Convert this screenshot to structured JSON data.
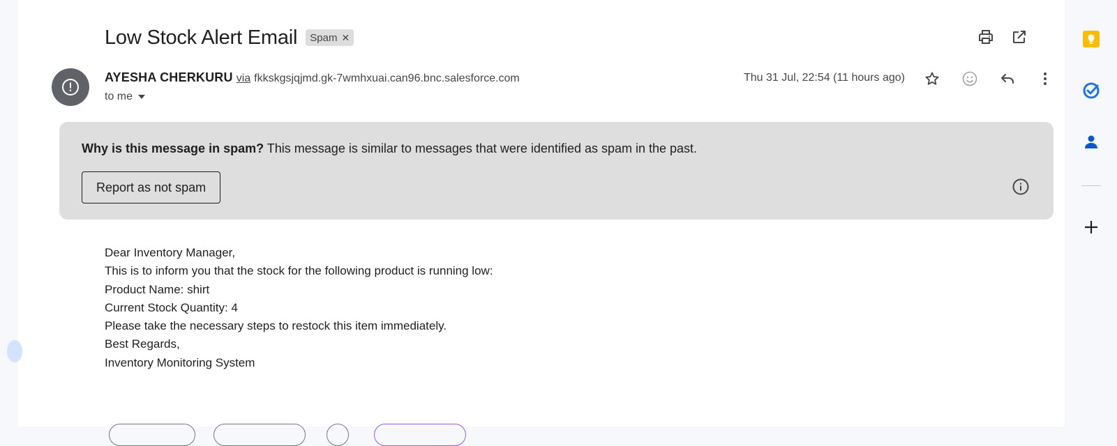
{
  "email": {
    "subject": "Low Stock Alert Email",
    "label": "Spam",
    "sender_name": "AYESHA CHERKURU",
    "via_text": "via",
    "sender_domain": "fkkskgsjqjmd.gk-7wmhxuai.can96.bnc.salesforce.com",
    "recipient": "to me",
    "date": "Thu 31 Jul, 22:54 (11 hours ago)"
  },
  "spam_banner": {
    "question": "Why is this message in spam?",
    "explanation": "This message is similar to messages that were identified as spam in the past.",
    "button_label": "Report as not spam"
  },
  "body_lines": [
    "Dear Inventory Manager,",
    "This is to inform you that the stock for the following product is running low:",
    "Product Name: shirt",
    "Current Stock Quantity: 4",
    "Please take the necessary steps to restock this item immediately.",
    "Best Regards,",
    "Inventory Monitoring System"
  ],
  "icons": {
    "top": [
      "print-icon",
      "open-in-new-window-icon"
    ],
    "message_actions": [
      "star-icon",
      "emoji-icon",
      "reply-icon",
      "more-options-icon"
    ],
    "side_panel": [
      "keep-icon",
      "tasks-icon",
      "contacts-icon",
      "add-icon"
    ]
  },
  "colors": {
    "banner_bg": "#dedede",
    "keep_yellow": "#fbbc04",
    "tasks_blue": "#1a73e8",
    "contacts_blue": "#0b57d0"
  }
}
